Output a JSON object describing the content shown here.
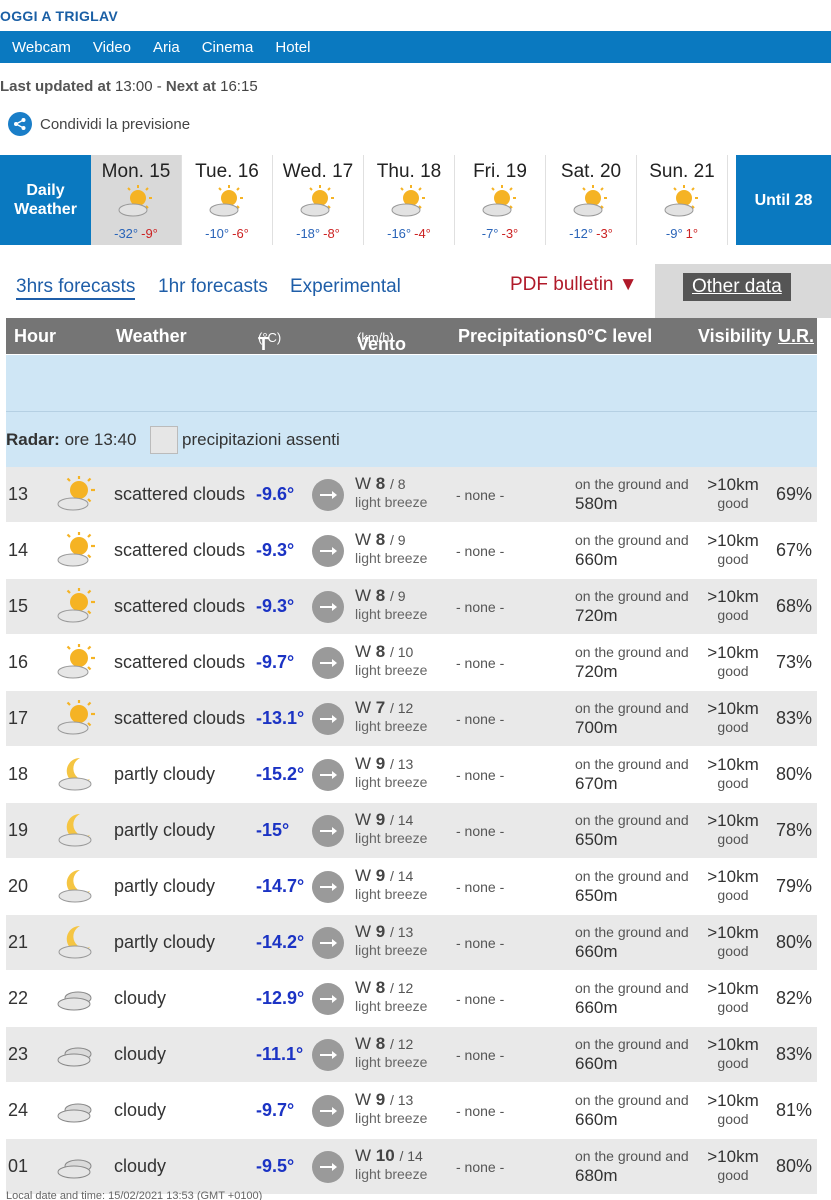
{
  "header": {
    "title": "OGGI A TRIGLAV"
  },
  "nav": [
    "Webcam",
    "Video",
    "Aria",
    "Cinema",
    "Hotel"
  ],
  "updated": {
    "label1": "Last updated at",
    "time1": "13:00",
    "sep": "-",
    "label2": "Next at",
    "time2": "16:15"
  },
  "share": {
    "label": "Condividi la previsione"
  },
  "days": {
    "daily_label": "Daily Weather",
    "until_label": "Until 28",
    "items": [
      {
        "name": "Mon. 15",
        "min": "-32°",
        "max": "-9°",
        "icon": "sun-cloud-icon"
      },
      {
        "name": "Tue. 16",
        "min": "-10°",
        "max": "-6°",
        "icon": "sun-cloud-icon"
      },
      {
        "name": "Wed. 17",
        "min": "-18°",
        "max": "-8°",
        "icon": "sun-cloud-icon"
      },
      {
        "name": "Thu. 18",
        "min": "-16°",
        "max": "-4°",
        "icon": "sun-cloud-icon"
      },
      {
        "name": "Fri. 19",
        "min": "-7°",
        "max": "-3°",
        "icon": "sun-cloud-icon"
      },
      {
        "name": "Sat. 20",
        "min": "-12°",
        "max": "-3°",
        "icon": "sun-cloud-icon"
      },
      {
        "name": "Sun. 21",
        "min": "-9°",
        "max": "1°",
        "icon": "sun-cloud-icon"
      }
    ]
  },
  "tabs": {
    "t3h": "3hrs forecasts",
    "t1h": "1hr forecasts",
    "exp": "Experimental",
    "pdf": "PDF bulletin ▼",
    "other": "Other data"
  },
  "table": {
    "headers": {
      "hour": "Hour",
      "weather": "Weather",
      "temp": "T",
      "temp_unit": "(°C)",
      "wind": "Vento",
      "wind_unit": "(km/h)",
      "prec": "Precipitations",
      "zero": "0°C level",
      "vis": "Visibility",
      "hum": "U.R."
    },
    "radar": {
      "label": "Radar:",
      "time": "ore 13:40",
      "status": "precipitazioni assenti"
    },
    "rows": [
      {
        "hour": "13",
        "icon": "sun-cloud-icon",
        "desc": "scattered clouds",
        "temp": "-9.6°",
        "dir": "W",
        "speed": "8",
        "gust": "/ 8",
        "breeze": "light breeze",
        "prec": "- none -",
        "zero_s": "on the ground and",
        "zero_v": "580m",
        "vis": ">10km",
        "vis_s": "good",
        "hum": "69%"
      },
      {
        "hour": "14",
        "icon": "sun-cloud-icon",
        "desc": "scattered clouds",
        "temp": "-9.3°",
        "dir": "W",
        "speed": "8",
        "gust": "/ 9",
        "breeze": "light breeze",
        "prec": "- none -",
        "zero_s": "on the ground and",
        "zero_v": "660m",
        "vis": ">10km",
        "vis_s": "good",
        "hum": "67%"
      },
      {
        "hour": "15",
        "icon": "sun-cloud-icon",
        "desc": "scattered clouds",
        "temp": "-9.3°",
        "dir": "W",
        "speed": "8",
        "gust": "/ 9",
        "breeze": "light breeze",
        "prec": "- none -",
        "zero_s": "on the ground and",
        "zero_v": "720m",
        "vis": ">10km",
        "vis_s": "good",
        "hum": "68%"
      },
      {
        "hour": "16",
        "icon": "sun-cloud-icon",
        "desc": "scattered clouds",
        "temp": "-9.7°",
        "dir": "W",
        "speed": "8",
        "gust": "/ 10",
        "breeze": "light breeze",
        "prec": "- none -",
        "zero_s": "on the ground and",
        "zero_v": "720m",
        "vis": ">10km",
        "vis_s": "good",
        "hum": "73%"
      },
      {
        "hour": "17",
        "icon": "sun-cloud-icon",
        "desc": "scattered clouds",
        "temp": "-13.1°",
        "dir": "W",
        "speed": "7",
        "gust": "/ 12",
        "breeze": "light breeze",
        "prec": "- none -",
        "zero_s": "on the ground and",
        "zero_v": "700m",
        "vis": ">10km",
        "vis_s": "good",
        "hum": "83%"
      },
      {
        "hour": "18",
        "icon": "moon-cloud-icon",
        "desc": "partly cloudy",
        "temp": "-15.2°",
        "dir": "W",
        "speed": "9",
        "gust": "/ 13",
        "breeze": "light breeze",
        "prec": "- none -",
        "zero_s": "on the ground and",
        "zero_v": "670m",
        "vis": ">10km",
        "vis_s": "good",
        "hum": "80%"
      },
      {
        "hour": "19",
        "icon": "moon-cloud-icon",
        "desc": "partly cloudy",
        "temp": "-15°",
        "dir": "W",
        "speed": "9",
        "gust": "/ 14",
        "breeze": "light breeze",
        "prec": "- none -",
        "zero_s": "on the ground and",
        "zero_v": "650m",
        "vis": ">10km",
        "vis_s": "good",
        "hum": "78%"
      },
      {
        "hour": "20",
        "icon": "moon-cloud-icon",
        "desc": "partly cloudy",
        "temp": "-14.7°",
        "dir": "W",
        "speed": "9",
        "gust": "/ 14",
        "breeze": "light breeze",
        "prec": "- none -",
        "zero_s": "on the ground and",
        "zero_v": "650m",
        "vis": ">10km",
        "vis_s": "good",
        "hum": "79%"
      },
      {
        "hour": "21",
        "icon": "moon-cloud-icon",
        "desc": "partly cloudy",
        "temp": "-14.2°",
        "dir": "W",
        "speed": "9",
        "gust": "/ 13",
        "breeze": "light breeze",
        "prec": "- none -",
        "zero_s": "on the ground and",
        "zero_v": "660m",
        "vis": ">10km",
        "vis_s": "good",
        "hum": "80%"
      },
      {
        "hour": "22",
        "icon": "cloud-icon",
        "desc": "cloudy",
        "temp": "-12.9°",
        "dir": "W",
        "speed": "8",
        "gust": "/ 12",
        "breeze": "light breeze",
        "prec": "- none -",
        "zero_s": "on the ground and",
        "zero_v": "660m",
        "vis": ">10km",
        "vis_s": "good",
        "hum": "82%"
      },
      {
        "hour": "23",
        "icon": "cloud-icon",
        "desc": "cloudy",
        "temp": "-11.1°",
        "dir": "W",
        "speed": "8",
        "gust": "/ 12",
        "breeze": "light breeze",
        "prec": "- none -",
        "zero_s": "on the ground and",
        "zero_v": "660m",
        "vis": ">10km",
        "vis_s": "good",
        "hum": "83%"
      },
      {
        "hour": "24",
        "icon": "cloud-icon",
        "desc": "cloudy",
        "temp": "-9.7°",
        "dir": "W",
        "speed": "9",
        "gust": "/ 13",
        "breeze": "light breeze",
        "prec": "- none -",
        "zero_s": "on the ground and",
        "zero_v": "660m",
        "vis": ">10km",
        "vis_s": "good",
        "hum": "81%"
      },
      {
        "hour": "01",
        "icon": "cloud-icon",
        "desc": "cloudy",
        "temp": "-9.5°",
        "dir": "W",
        "speed": "10",
        "gust": "/ 14",
        "breeze": "light breeze",
        "prec": "- none -",
        "zero_s": "on the ground and",
        "zero_v": "680m",
        "vis": ">10km",
        "vis_s": "good",
        "hum": "80%"
      }
    ]
  },
  "footer": {
    "text": "Local date and time: 15/02/2021 13:53 (GMT +0100)"
  },
  "colors": {
    "brand": "#0a79c0",
    "temp": "#1b33c4",
    "pdf": "#b01a2a",
    "min": "#2a64b8",
    "max": "#cc2222"
  }
}
